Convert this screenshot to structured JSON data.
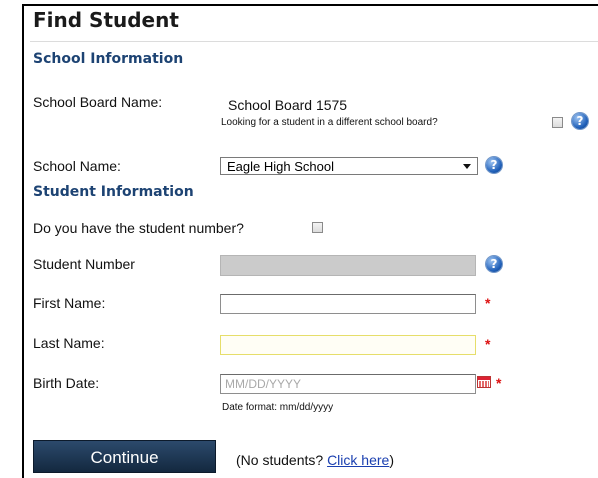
{
  "page": {
    "title": "Find Student"
  },
  "school_info": {
    "heading": "School Information",
    "board_label": "School Board Name:",
    "board_value": "School Board 1575",
    "different_board_text": "Looking for a student in a different school board?",
    "school_label": "School Name:",
    "school_selected": "Eagle High School"
  },
  "student_info": {
    "heading": "Student Information",
    "have_number_label": "Do you have the student number?",
    "student_number_label": "Student Number",
    "first_name_label": "First Name:",
    "last_name_label": "Last Name:",
    "birth_date_label": "Birth Date:",
    "birth_date_placeholder": "MM/DD/YYYY",
    "date_format_hint": "Date format: mm/dd/yyyy",
    "required_mark": "*"
  },
  "actions": {
    "continue_label": "Continue",
    "no_students_prefix": "(No students? ",
    "click_here": "Click here",
    "no_students_suffix": ")"
  },
  "icons": {
    "help": "help-question-icon",
    "calendar": "calendar-icon",
    "dropdown": "chevron-down-icon"
  },
  "colors": {
    "section_heading": "#1d4373",
    "button_bg": "#1b3350",
    "required": "#dd1111",
    "link": "#1a3fb0"
  }
}
